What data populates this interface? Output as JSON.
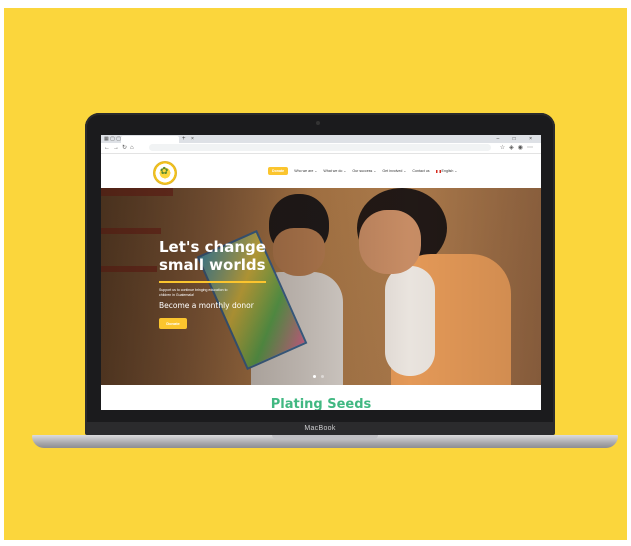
{
  "background_color": "#fbd63c",
  "device": {
    "label": "MacBook"
  },
  "browser": {
    "tab_close": "×",
    "new_tab": "+",
    "window_controls": "–  □  ×",
    "nav_icons": [
      "back-icon",
      "forward-icon",
      "reload-icon",
      "home-icon"
    ],
    "toolbar_icons": [
      "bookmark-icon",
      "extensions-icon",
      "profile-icon",
      "menu-icon"
    ]
  },
  "site": {
    "nav": {
      "items": [
        {
          "label": "Donate",
          "active": true
        },
        {
          "label": "Who we are ⌄"
        },
        {
          "label": "What we do ⌄"
        },
        {
          "label": "Our success ⌄"
        },
        {
          "label": "Get involved ⌄"
        },
        {
          "label": "Contact us"
        },
        {
          "label": "English ⌄"
        }
      ]
    },
    "hero": {
      "title_line1": "Let's change",
      "title_line2": "small worlds",
      "subtitle": "Support us to continue bringing education to children in Guatemala!",
      "cta_text": "Become a monthly donor",
      "button_label": "Donate",
      "slide_count": 2,
      "active_slide": 1
    },
    "section_title": "Plating Seeds",
    "colors": {
      "accent": "#fbc52e",
      "section_title": "#41b882"
    }
  }
}
